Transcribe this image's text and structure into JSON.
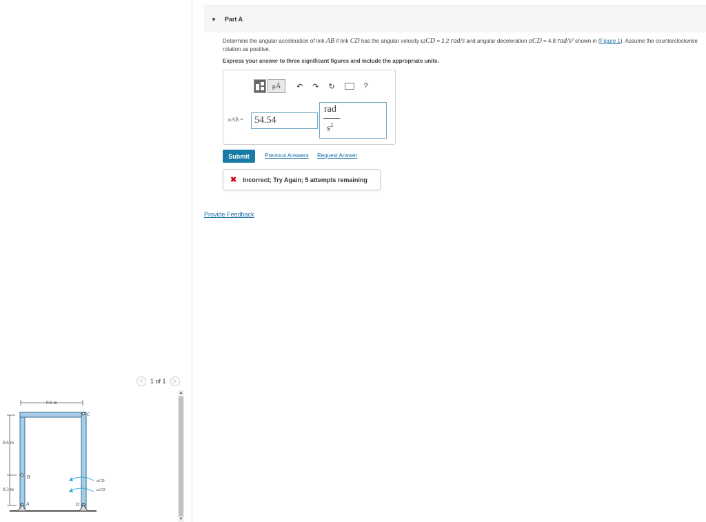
{
  "figure_pager": {
    "text": "1 of 1",
    "prev": "<",
    "next": ">"
  },
  "figure": {
    "dim_top": "0.6 m",
    "dim_left_upper": "0.6 m",
    "dim_left_lower": "0.3 m",
    "label_A": "A",
    "label_B": "B",
    "label_C": "C",
    "label_D": "D",
    "alpha_cd": "αCD",
    "omega_cd": "ωCD",
    "member_color": "#a8cde4",
    "member_edge": "#2c6e9b"
  },
  "part": {
    "title": "Part A",
    "caret": "▼"
  },
  "question": {
    "pre": "Determine the angular acceleration of link ",
    "link1": "AB",
    "mid1": " if link ",
    "link2": "CD",
    "mid2": " has the angular velocity ",
    "omega": "ωCD",
    "omega_val": " = 2.2 ",
    "omega_unit": "rad/s",
    "mid3": " and angular deceleration ",
    "alpha": "αCD",
    "alpha_val": " = 4.8 ",
    "alpha_unit": "rad/s²",
    "mid4": " shown in (",
    "figure_link": "Figure 1",
    "post": "). Assume the counterclockwise rotation as positive."
  },
  "instruction": "Express your answer to three significant figures and include the appropriate units.",
  "toolbar": {
    "units_btn": "μÅ",
    "undo": "↶",
    "redo": "↷",
    "reset": "↻",
    "help": "?"
  },
  "answer": {
    "label": "αAB =",
    "value": "54.54",
    "unit_num": "rad",
    "unit_den": "s",
    "unit_den_exp": "2"
  },
  "actions": {
    "submit": "Submit",
    "previous_answers": "Previous Answers",
    "request_answer": "Request Answer"
  },
  "feedback": {
    "icon": "✖",
    "message": "Incorrect; Try Again; 5 attempts remaining"
  },
  "provide_feedback": "Provide Feedback"
}
